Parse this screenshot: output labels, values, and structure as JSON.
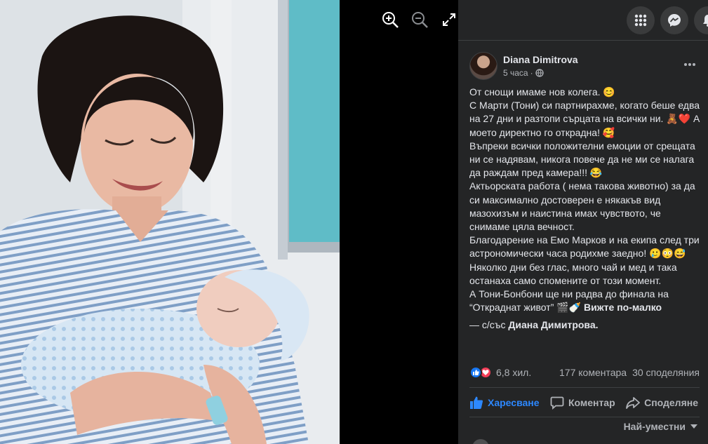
{
  "viewer": {
    "icons": [
      "zoom-in-icon",
      "zoom-out-icon",
      "fullscreen-icon"
    ]
  },
  "topbar": {
    "icons": [
      "menu-grid-icon",
      "messenger-icon",
      "notifications-icon"
    ]
  },
  "post": {
    "author": "Diana Dimitrova",
    "time": "5 часа",
    "separator": "·",
    "privacy_icon": "globe-icon",
    "lines": [
      "От снощи имаме нов колега. 😊",
      "С Марти (Тони) си партнирахме, когато беше едва на 27 дни и разтопи сърцата на всички ни. 🧸❤️ А моето директно го открадна! 🥰",
      "Въпреки всички положителни емоции от срещата ни се надявам, никога повече да не ми се налага да раждам пред камера!!! 😂",
      "Актьорската работа ( нема такова животно) за да си максимално достоверен е някакъв вид мазохизъм и наистина имах чувството, че снимаме цяла вечност.",
      "Благодарение на Емо Марков и на екипа след три астрономически часа родихме заедно! 🥲😳😅",
      "Няколко дни без глас, много чай и мед и така останаха само спомените от този момент.",
      "А Тони-Бонбони ще ни радва до финала на “Откраднат живот” 🎬🍼"
    ],
    "see_less": "Вижте по-малко",
    "with_prefix": "— с/със",
    "with_name": "Диана Димитрова."
  },
  "stats": {
    "reactions": "6,8 хил.",
    "comments": "177 коментара",
    "shares": "30 споделяния"
  },
  "actions": {
    "like": "Харесване",
    "comment": "Коментар",
    "share": "Споделяне"
  },
  "sort": {
    "label": "Най-уместни"
  },
  "colors": {
    "panel_bg": "#242526",
    "text": "#e4e6eb",
    "secondary": "#b0b3b8",
    "like_blue": "#2d88ff",
    "love_red": "#f33e58"
  }
}
